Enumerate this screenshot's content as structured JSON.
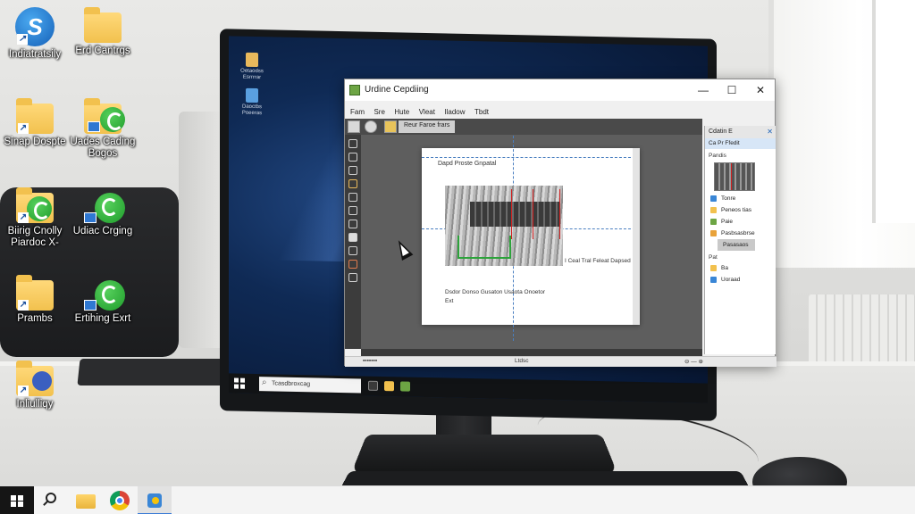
{
  "desktop": {
    "icons": [
      {
        "label": "Indiatratsily"
      },
      {
        "label": "Erd Cantrgs"
      },
      {
        "label": "Sinap Dospte"
      },
      {
        "label": "Uades Cading Bogos"
      },
      {
        "label": "Biirig Cnolly Piardoc X-"
      },
      {
        "label": "Udiac Crging"
      },
      {
        "label": "Prambs"
      },
      {
        "label": "Ertihing Exrt"
      },
      {
        "label": "Inliulliqy"
      }
    ]
  },
  "monitor": {
    "screen_icons": [
      {
        "label": "Oetaodss Esrrrrar"
      },
      {
        "label": "Daoctbs Poeeras"
      }
    ],
    "search_placeholder": "Tcasdbroxcag"
  },
  "app": {
    "title": "Urdine Cepdiing",
    "menu": [
      "Fam",
      "Sre",
      "Hute",
      "Vleat",
      "Iladow",
      "Tbdt"
    ],
    "toolbar_label": "Reur Faroe frars",
    "document": {
      "heading": "Dapd Proste Gnpatal",
      "side_note": "I Ceal Tral Feleat Dapsed",
      "caption": "Dsdor Donso Gusaton Usaota Onoetor",
      "caption2": "Ext"
    },
    "canvas_status": "Ltdsc",
    "panel": {
      "title": "Cdatin E",
      "subtitle": "Ca Pr Ffedit",
      "section_label": "Pandis",
      "items": [
        "Tonre",
        "Peneos tias",
        "Paie",
        "Pasbsasbrse"
      ],
      "selected": "Pasasaos",
      "section2": "Pat",
      "items2": [
        "Ba",
        "Uoraad"
      ]
    }
  },
  "colors": {
    "accent": "#3a7bd5",
    "green_badge": "#2da33b",
    "red_guide": "#d21f1f"
  }
}
